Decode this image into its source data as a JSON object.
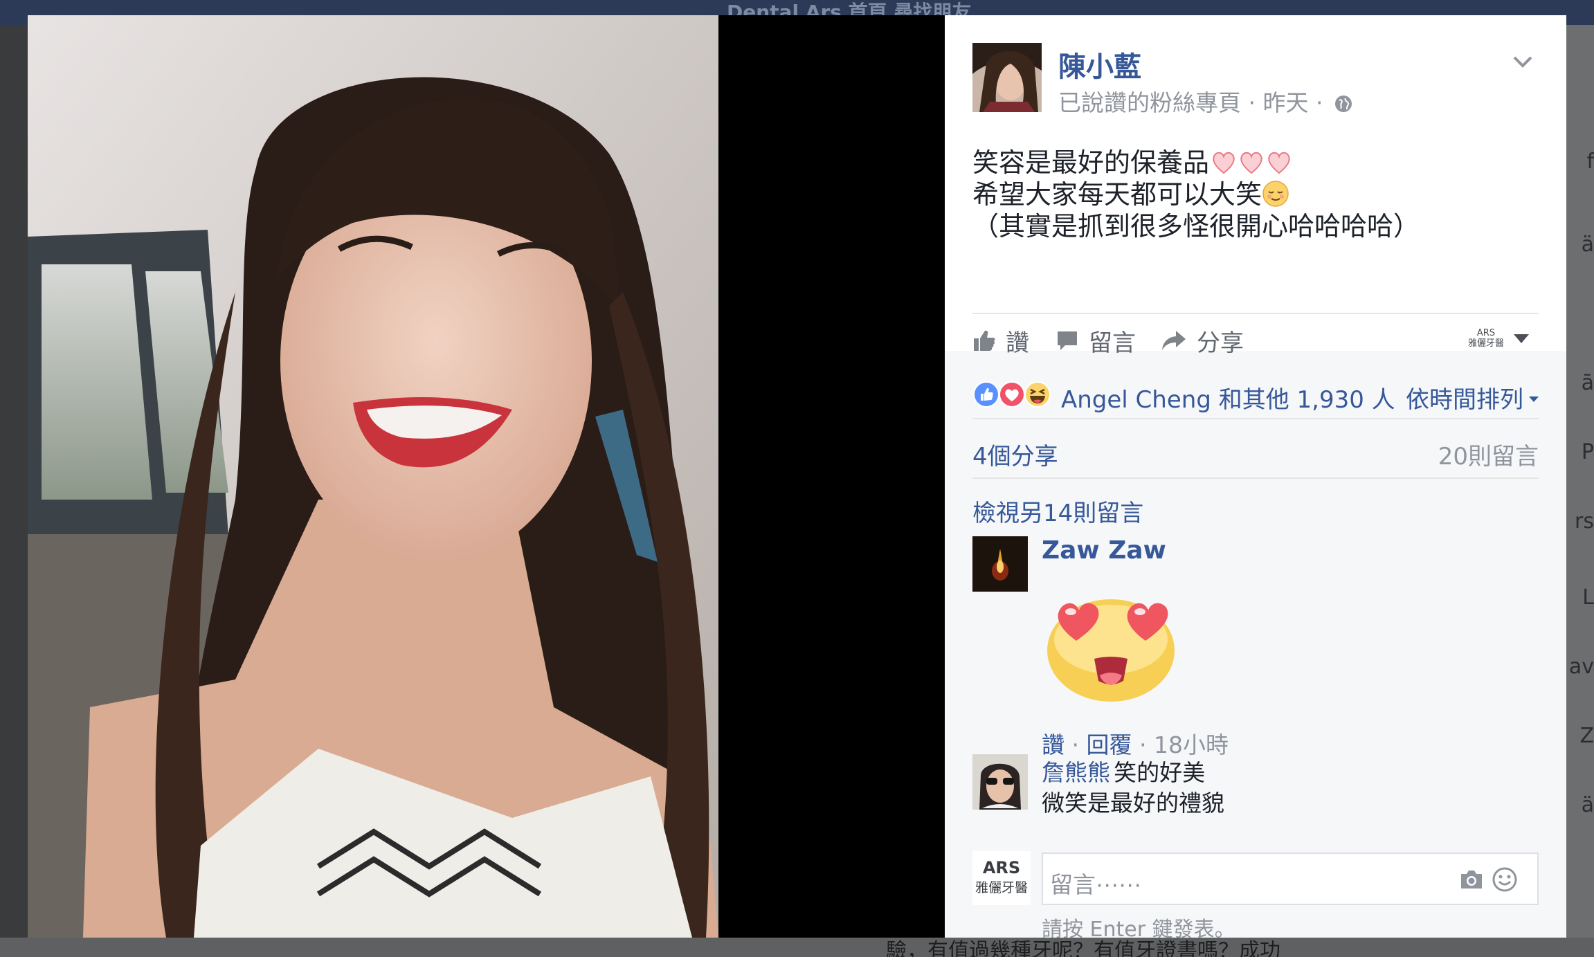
{
  "background": {
    "topbar_text": "Dental Ars   首頁   尋找朋友",
    "right_fragments": [
      "f",
      "ä",
      "ā",
      "P",
      "rs",
      "L",
      "av",
      "Z",
      "ä"
    ],
    "bottom_text": "驗，有值過幾種牙呢？有值牙證書嗎？成功"
  },
  "post": {
    "author": "陳小藍",
    "meta": "已說讚的粉絲專頁 · 昨天 ·",
    "lines": [
      "笑容是最好的保養品",
      "希望大家每天都可以大笑",
      "（其實是抓到很多怪很開心哈哈哈哈）"
    ],
    "emojis": {
      "line1": "heart",
      "line2": "relieved-face"
    }
  },
  "actions": {
    "like": "讚",
    "comment": "留言",
    "share": "分享",
    "page_badge_line1": "ARS",
    "page_badge_line2": "雅儷牙醫"
  },
  "reactions": {
    "text": "Angel Cheng 和其他 1,930 人",
    "sort": "依時間排列",
    "types": [
      "like",
      "love",
      "haha"
    ]
  },
  "counts": {
    "shares": "4個分享",
    "comments": "20則留言"
  },
  "comments": {
    "view_more": "檢視另14則留言",
    "items": [
      {
        "name": "Zaw Zaw",
        "text": "",
        "sticker": "heart-eyes-face",
        "like": "讚",
        "reply": "回覆",
        "time": "18小時"
      },
      {
        "name": "詹熊熊",
        "text": "笑的好美",
        "text2": "微笑是最好的禮貌"
      }
    ]
  },
  "composer": {
    "logo_line1": "ARS",
    "logo_line2": "雅儷牙醫",
    "placeholder": "留言⋯⋯",
    "hint": "請按 Enter 鍵發表。"
  },
  "colors": {
    "link": "#365899",
    "meta": "#90949c",
    "text": "#1d2129",
    "panel_bg": "#f6f7f9"
  }
}
